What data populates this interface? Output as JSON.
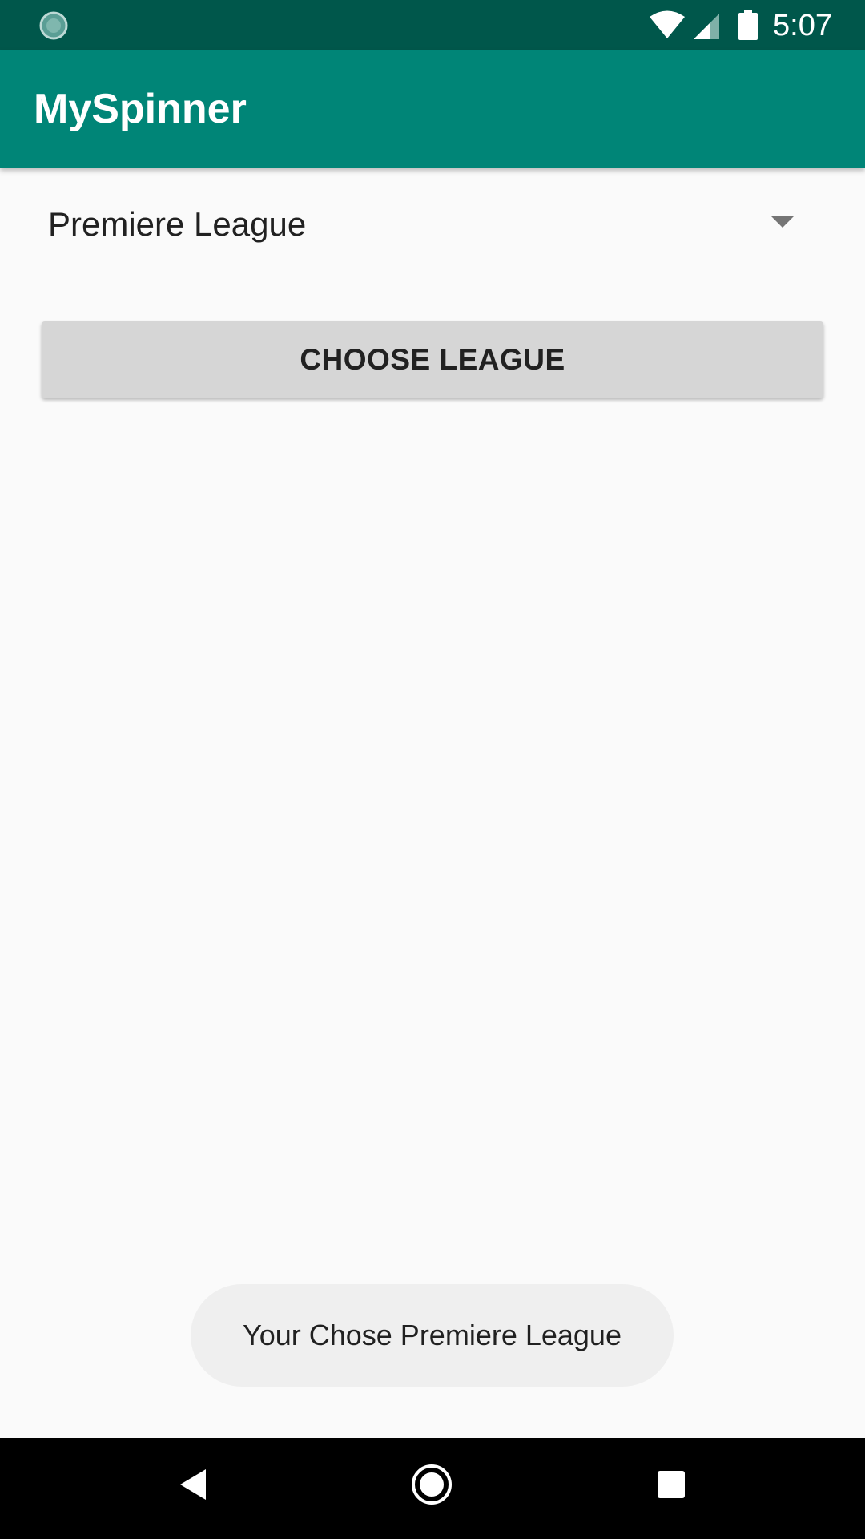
{
  "status_bar": {
    "time": "5:07",
    "left_icon": "sync-status-icon",
    "icons": [
      "wifi-icon",
      "cell-signal-icon",
      "battery-icon"
    ],
    "background": "#00574b"
  },
  "app_bar": {
    "title": "MySpinner",
    "background": "#008577"
  },
  "spinner": {
    "selected": "Premiere League",
    "icon": "dropdown-arrow-icon"
  },
  "button": {
    "label": "CHOOSE LEAGUE"
  },
  "toast": {
    "message": "Your Chose Premiere League"
  },
  "nav_bar": {
    "icons": [
      "back-icon",
      "home-icon",
      "recents-icon"
    ]
  }
}
